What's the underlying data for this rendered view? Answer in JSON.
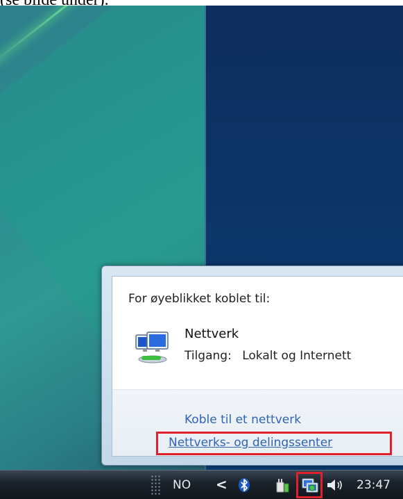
{
  "caption": "(se bilde under).",
  "popup": {
    "heading": "For øyeblikket koblet til:",
    "network_name": "Nettverk",
    "access_label": "Tilgang:",
    "access_value": "Lokalt og Internett",
    "link_connect": "Koble til et nettverk",
    "link_center": "Nettverks- og delingssenter",
    "network_icon": "network-computers-icon"
  },
  "taskbar": {
    "language": "NO",
    "chevron": "<",
    "clock": "23:47",
    "icons": [
      "bluetooth-icon",
      "power-icon",
      "network-icon",
      "volume-icon"
    ]
  },
  "highlight_color": "#e0202c",
  "link_color": "#2d64b3"
}
